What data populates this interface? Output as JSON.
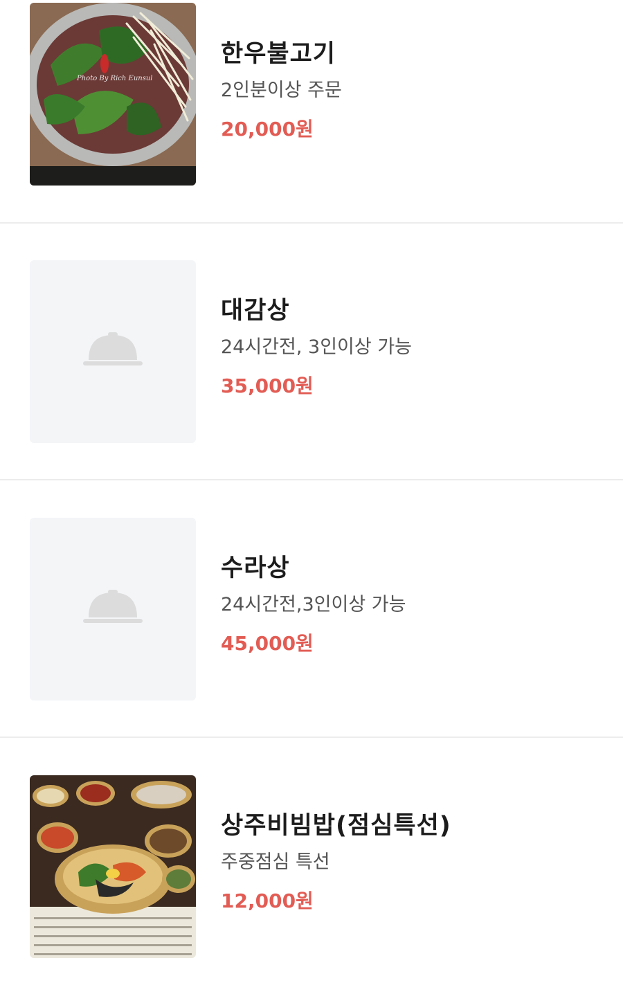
{
  "menu": {
    "items": [
      {
        "name": "한우불고기",
        "description": "2인분이상 주문",
        "price": "20,000원",
        "image": "bulgogi-hotpot-photo",
        "watermark": "Photo By Rich Eunsul"
      },
      {
        "name": "대감상",
        "description": "24시간전, 3인이상 가능",
        "price": "35,000원",
        "image": "food-cloche-placeholder-icon"
      },
      {
        "name": "수라상",
        "description": "24시간전,3인이상 가능",
        "price": "45,000원",
        "image": "food-cloche-placeholder-icon"
      },
      {
        "name": "상주비빔밥(점심특선)",
        "description": "주중점심 특선",
        "price": "12,000원",
        "image": "bibimbap-set-photo"
      }
    ]
  },
  "colors": {
    "price": "#e25c54",
    "placeholder_bg": "#f4f5f7",
    "divider": "#ececec"
  }
}
